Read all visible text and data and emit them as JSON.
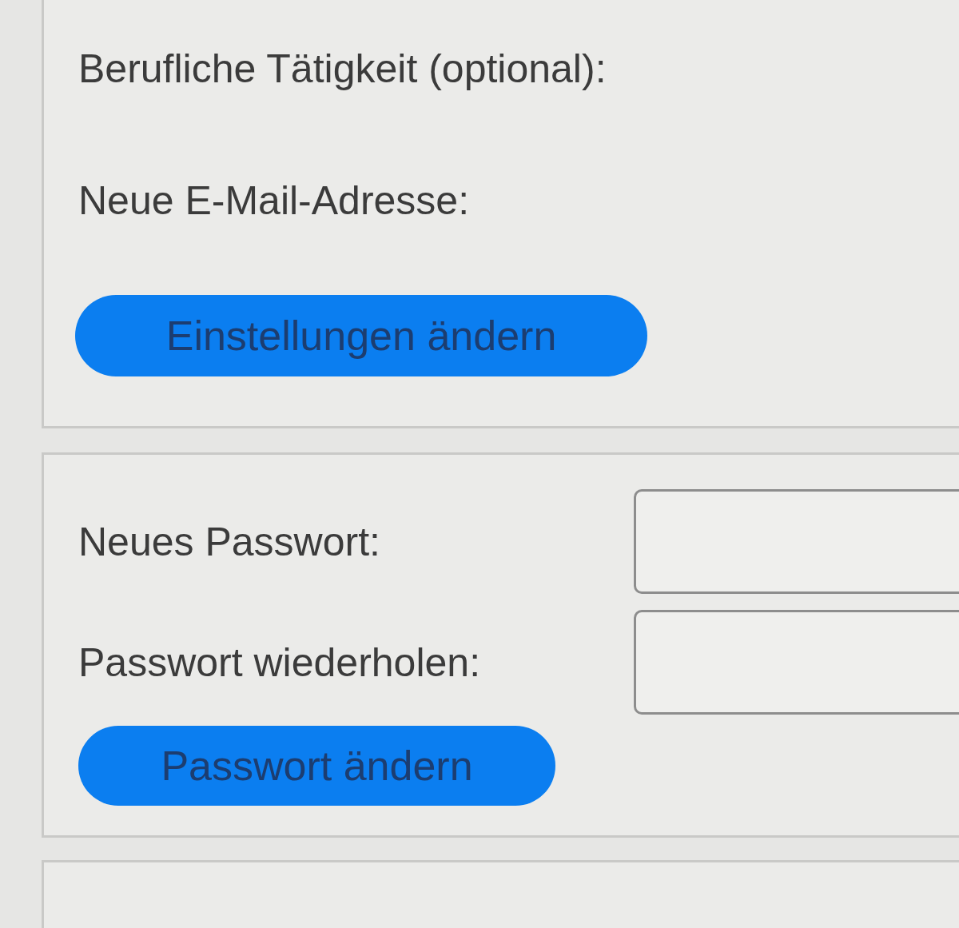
{
  "sections": [
    {
      "kind": "form",
      "fields": [
        {
          "label": "Berufliche Tätigkeit (optional):",
          "has_input": false
        },
        {
          "label": "Neue E-Mail-Adresse:",
          "has_input": false
        }
      ],
      "button": "Einstellungen ändern"
    },
    {
      "kind": "form",
      "fields": [
        {
          "label": "Neues Passwort:",
          "has_input": true
        },
        {
          "label": "Passwort wiederholen:",
          "has_input": true
        }
      ],
      "button": "Passwort ändern"
    },
    {
      "kind": "blank"
    }
  ]
}
